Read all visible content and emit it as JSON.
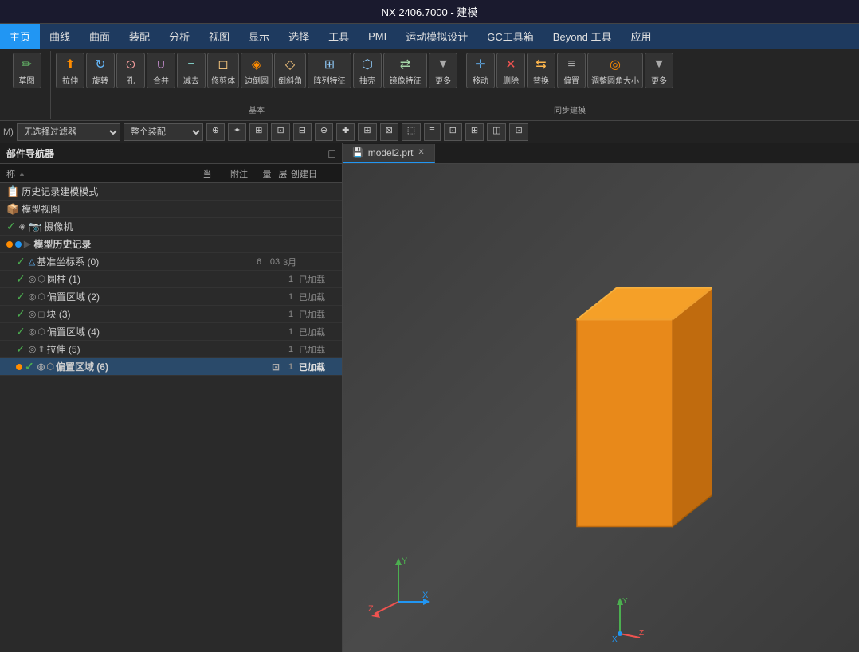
{
  "titlebar": {
    "title": "NX 2406.7000 - 建模"
  },
  "menubar": {
    "items": [
      {
        "label": "主页",
        "active": true
      },
      {
        "label": "曲线",
        "active": false
      },
      {
        "label": "曲面",
        "active": false
      },
      {
        "label": "装配",
        "active": false
      },
      {
        "label": "分析",
        "active": false
      },
      {
        "label": "视图",
        "active": false
      },
      {
        "label": "显示",
        "active": false
      },
      {
        "label": "选择",
        "active": false
      },
      {
        "label": "工具",
        "active": false
      },
      {
        "label": "PMI",
        "active": false
      },
      {
        "label": "运动模拟设计",
        "active": false
      },
      {
        "label": "GC工具箱",
        "active": false
      },
      {
        "label": "Beyond 工具",
        "active": false
      },
      {
        "label": "应用",
        "active": false
      }
    ]
  },
  "toolbar": {
    "groups": [
      {
        "label": "",
        "buttons": [
          {
            "icon": "✏️",
            "label": "草图"
          },
          {
            "icon": "↕",
            "label": "拉伸"
          },
          {
            "icon": "↻",
            "label": "旋转"
          },
          {
            "icon": "⊙",
            "label": "孔"
          },
          {
            "icon": "∪",
            "label": "合并"
          },
          {
            "icon": "−",
            "label": "减去"
          },
          {
            "icon": "◻",
            "label": "修剪体"
          },
          {
            "icon": "◈",
            "label": "边倒圆"
          },
          {
            "icon": "◇",
            "label": "倒斜角"
          }
        ]
      }
    ],
    "basic_label": "基本",
    "sync_label": "同步建模",
    "array_btn": "阵列特征",
    "more_btn": "更多",
    "shell_btn": "抽壳",
    "mirror_btn": "镜像特征",
    "move_btn": "移动",
    "delete_btn": "删除",
    "replace_btn": "替换",
    "offset_btn": "偏置",
    "adjust_btn": "调整圆角大小",
    "more2_btn": "更多"
  },
  "toolbar2": {
    "filter_placeholder": "无选择过滤器",
    "assembly_placeholder": "整个装配",
    "filter_value": "无选择过滤器",
    "assembly_value": "整个装配"
  },
  "nav": {
    "title": "部件导航器",
    "columns": {
      "name": "称",
      "current": "当",
      "note": "附注",
      "qty": "量",
      "layer": "层",
      "created": "创建日"
    },
    "items": [
      {
        "indent": 1,
        "icon": "📋",
        "name": "历史记录建模模式",
        "current": "",
        "note": "",
        "qty": "",
        "layer": "",
        "created": "",
        "check": false,
        "bold": false
      },
      {
        "indent": 1,
        "icon": "📦",
        "name": "模型视图",
        "current": "",
        "note": "",
        "qty": "",
        "layer": "",
        "created": "",
        "check": false,
        "bold": false
      },
      {
        "indent": 1,
        "icon": "📷",
        "name": "摄像机",
        "current": "",
        "note": "",
        "qty": "",
        "layer": "",
        "created": "",
        "check": true,
        "bold": false
      },
      {
        "indent": 1,
        "icon": "📁",
        "name": "模型历史记录",
        "current": "",
        "note": "",
        "qty": "",
        "layer": "",
        "created": "",
        "check": true,
        "bold": true,
        "dot": "orange"
      },
      {
        "indent": 2,
        "icon": "△",
        "name": "基准坐标系 (0)",
        "current": "",
        "note": "",
        "qty": "6",
        "layer": "03",
        "created": "3月",
        "check": true,
        "bold": false
      },
      {
        "indent": 2,
        "icon": "⬡",
        "name": "圆柱 (1)",
        "current": "",
        "note": "已加载",
        "qty": "1",
        "layer": "",
        "created": "",
        "check": true,
        "bold": false
      },
      {
        "indent": 2,
        "icon": "⬡",
        "name": "偏置区域 (2)",
        "current": "",
        "note": "已加载",
        "qty": "1",
        "layer": "",
        "created": "",
        "check": true,
        "bold": false
      },
      {
        "indent": 2,
        "icon": "⬡",
        "name": "块 (3)",
        "current": "",
        "note": "已加载",
        "qty": "1",
        "layer": "",
        "created": "",
        "check": true,
        "bold": false
      },
      {
        "indent": 2,
        "icon": "⬡",
        "name": "偏置区域 (4)",
        "current": "",
        "note": "已加载",
        "qty": "1",
        "layer": "",
        "created": "",
        "check": true,
        "bold": false
      },
      {
        "indent": 2,
        "icon": "⬡",
        "name": "拉伸 (5)",
        "current": "",
        "note": "已加载",
        "qty": "1",
        "layer": "",
        "created": "",
        "check": true,
        "bold": false
      },
      {
        "indent": 2,
        "icon": "⬡",
        "name": "偏置区域 (6)",
        "current": "⊡",
        "note": "已加载",
        "qty": "1",
        "layer": "",
        "created": "",
        "check": true,
        "bold": true,
        "selected": true
      }
    ]
  },
  "viewport": {
    "tab_label": "model2.prt",
    "tab_save_icon": "💾",
    "tab_close": "✕"
  },
  "colors": {
    "accent_blue": "#2196f3",
    "box_orange_face": "#e8891a",
    "box_orange_top": "#f5a028",
    "box_orange_right": "#c06b0e",
    "background_dark": "#3a3a3a",
    "check_green": "#4caf50"
  }
}
